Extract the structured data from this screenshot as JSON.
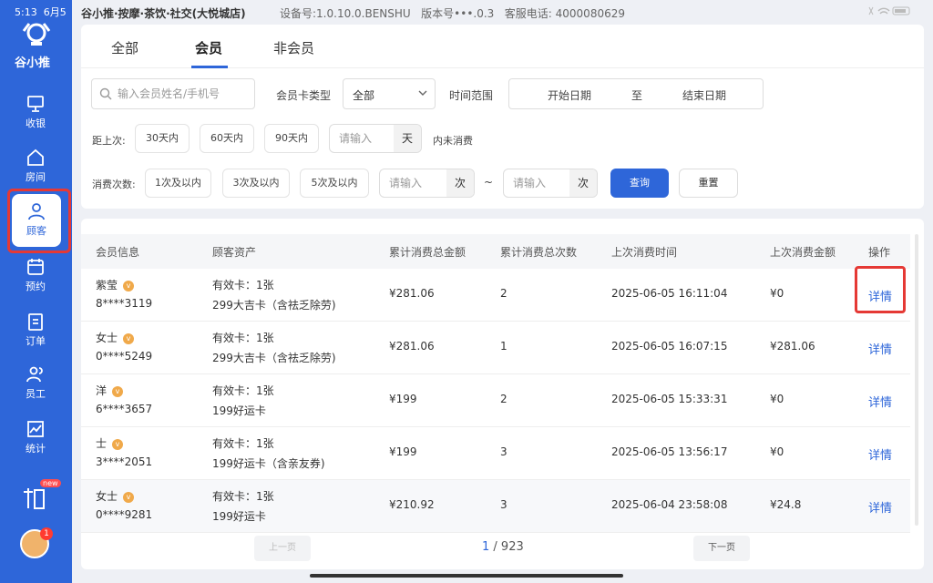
{
  "status": {
    "time": "5:13",
    "date": "6月5",
    "store": "谷小推·按摩·茶饮·社交(大悦城店)",
    "device_label": "设备号:",
    "device": "1.0.10.0.BENSHU",
    "version_label": "版本号",
    "version": "•••.0.3",
    "phone_label": "客服电话:",
    "phone": "4000080629"
  },
  "sidebar": {
    "brand": "谷小推",
    "items": [
      {
        "label": "收银",
        "icon": "cashier-icon"
      },
      {
        "label": "房间",
        "icon": "house-icon"
      },
      {
        "label": "顾客",
        "icon": "person-icon"
      },
      {
        "label": "预约",
        "icon": "calendar-icon"
      },
      {
        "label": "订单",
        "icon": "clipboard-icon"
      },
      {
        "label": "员工",
        "icon": "staff-icon"
      },
      {
        "label": "统计",
        "icon": "chart-icon"
      }
    ],
    "promo_badge": "new",
    "avatar_count": "1"
  },
  "tabs": [
    "全部",
    "会员",
    "非会员"
  ],
  "filters": {
    "search_placeholder": "输入会员姓名/手机号",
    "card_type_label": "会员卡类型",
    "card_type_value": "全部",
    "time_range_label": "时间范围",
    "start_date": "开始日期",
    "to": "至",
    "end_date": "结束日期",
    "last_label": "距上次:",
    "last_chips": [
      "30天内",
      "60天内",
      "90天内"
    ],
    "input_placeholder": "请输入",
    "unit_day": "天",
    "no_consume": "内未消费",
    "count_label": "消费次数:",
    "count_chips": [
      "1次及以内",
      "3次及以内",
      "5次及以内"
    ],
    "unit_times": "次",
    "tilde": "~",
    "query": "查询",
    "reset": "重置"
  },
  "table": {
    "headers": [
      "会员信息",
      "顾客资产",
      "累计消费总金额",
      "累计消费总次数",
      "上次消费时间",
      "上次消费金额",
      "操作"
    ],
    "rows": [
      {
        "name": "紫莹",
        "phone": "8****3119",
        "asset1": "有效卡：1张",
        "asset2": "299大吉卡（含祛乏除劳)",
        "total": "¥281.06",
        "count": "2",
        "last_time": "2025-06-05 16:11:04",
        "last_amount": "¥0",
        "action": "详情"
      },
      {
        "name": "女士",
        "phone": "0****5249",
        "asset1": "有效卡：1张",
        "asset2": "299大吉卡（含祛乏除劳)",
        "total": "¥281.06",
        "count": "1",
        "last_time": "2025-06-05 16:07:15",
        "last_amount": "¥281.06",
        "action": "详情"
      },
      {
        "name": "洋",
        "phone": "6****3657",
        "asset1": "有效卡：1张",
        "asset2": "199好运卡",
        "total": "¥199",
        "count": "2",
        "last_time": "2025-06-05 15:33:31",
        "last_amount": "¥0",
        "action": "详情"
      },
      {
        "name": "士",
        "phone": "3****2051",
        "asset1": "有效卡：1张",
        "asset2": "199好运卡（含亲友券)",
        "total": "¥199",
        "count": "3",
        "last_time": "2025-06-05 13:56:17",
        "last_amount": "¥0",
        "action": "详情"
      },
      {
        "name": "女士",
        "phone": "0****9281",
        "asset1": "有效卡：1张",
        "asset2": "199好运卡",
        "total": "¥210.92",
        "count": "3",
        "last_time": "2025-06-04 23:58:08",
        "last_amount": "¥24.8",
        "action": "详情"
      }
    ]
  },
  "pager": {
    "prev": "上一页",
    "current": "1",
    "total": " / 923",
    "next": "下一页"
  }
}
